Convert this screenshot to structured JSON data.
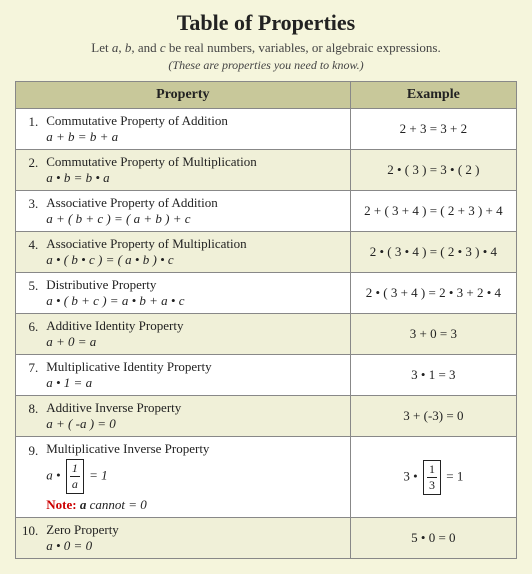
{
  "title": "Table of Properties",
  "subtitle": "Let a, b, and c be real numbers, variables, or algebraic expressions.",
  "note": "(These are properties you need to know.)",
  "headers": {
    "property": "Property",
    "example": "Example"
  },
  "rows": [
    {
      "num": "1.",
      "name": "Commutative Property of Addition",
      "formula": "a + b = b + a",
      "example": "2 + 3 = 3 + 2",
      "shaded": false
    },
    {
      "num": "2.",
      "name": "Commutative Property of Multiplication",
      "formula": "a • b = b • a",
      "example": "2 • ( 3 ) = 3 • ( 2 )",
      "shaded": true
    },
    {
      "num": "3.",
      "name": "Associative Property of Addition",
      "formula": "a + ( b + c ) = ( a + b ) + c",
      "example": "2 + ( 3 + 4 ) = ( 2 + 3 ) + 4",
      "shaded": false
    },
    {
      "num": "4.",
      "name": "Associative Property of Multiplication",
      "formula": "a • ( b • c ) = ( a • b ) • c",
      "example": "2 • ( 3 • 4 ) = ( 2 • 3 ) • 4",
      "shaded": true
    },
    {
      "num": "5.",
      "name": "Distributive Property",
      "formula": "a • ( b + c ) = a • b + a • c",
      "example": "2 • ( 3 + 4 ) = 2 • 3 + 2 • 4",
      "shaded": false
    },
    {
      "num": "6.",
      "name": "Additive Identity Property",
      "formula": "a + 0 = a",
      "example": "3 + 0 = 3",
      "shaded": true
    },
    {
      "num": "7.",
      "name": "Multiplicative Identity Property",
      "formula": "a • 1 = a",
      "example": "3 • 1 = 3",
      "shaded": false
    },
    {
      "num": "8.",
      "name": "Additive Inverse Property",
      "formula": "a + ( -a ) = 0",
      "example": "3 + (-3) = 0",
      "shaded": true
    },
    {
      "num": "9.",
      "name": "Multiplicative Inverse Property",
      "formula_special": true,
      "note": "Note: a cannot = 0",
      "example_special": true,
      "shaded": false
    },
    {
      "num": "10.",
      "name": "Zero Property",
      "formula": "a • 0 = 0",
      "example": "5 • 0 = 0",
      "shaded": true
    }
  ]
}
